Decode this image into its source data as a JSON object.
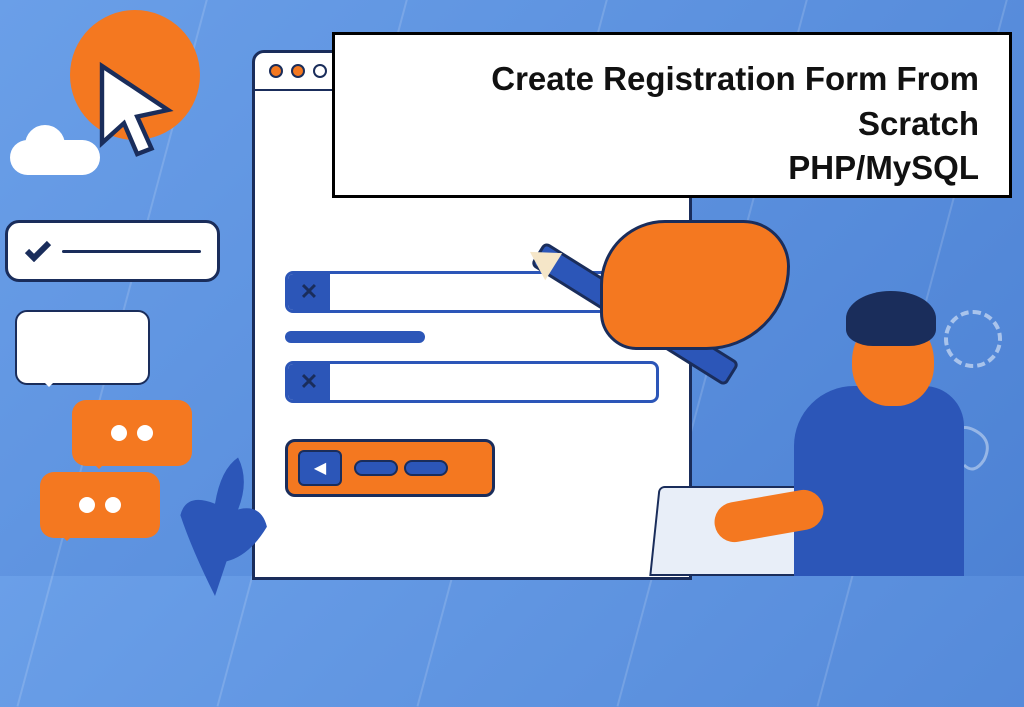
{
  "title": {
    "line1": "Create Registration Form From Scratch",
    "line2": "PHP/MySQL"
  },
  "form": {
    "field1_icon": "✕",
    "field2_icon": "✕",
    "play_icon": "◀"
  }
}
